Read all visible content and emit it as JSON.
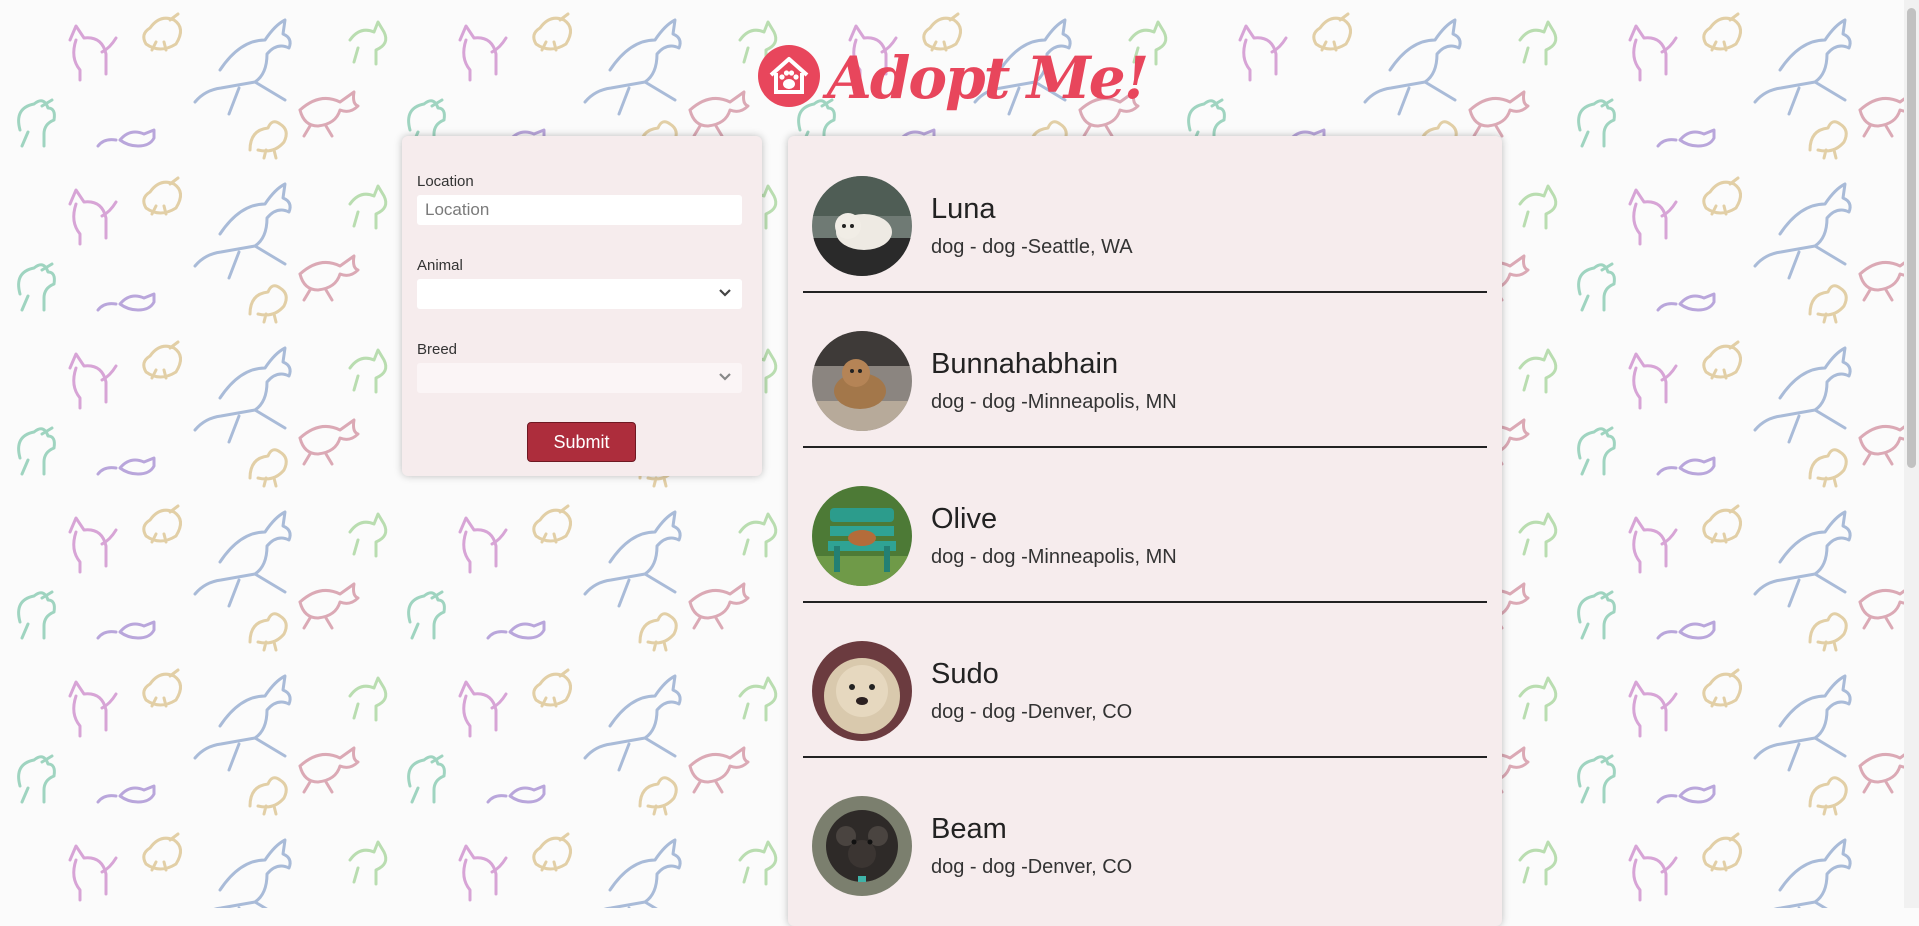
{
  "brand": {
    "title": "Adopt Me!",
    "logo_icon": "house-paw-icon",
    "color": "#e8465c"
  },
  "search": {
    "location": {
      "label": "Location",
      "placeholder": "Location",
      "value": ""
    },
    "animal": {
      "label": "Animal",
      "value": ""
    },
    "breed": {
      "label": "Breed",
      "value": ""
    },
    "submit_label": "Submit",
    "submit_color": "#ad2d3c"
  },
  "results": [
    {
      "name": "Luna",
      "info": "dog - dog -Seattle, WA"
    },
    {
      "name": "Bunnahabhain",
      "info": "dog - dog -Minneapolis, MN"
    },
    {
      "name": "Olive",
      "info": "dog - dog -Minneapolis, MN"
    },
    {
      "name": "Sudo",
      "info": "dog - dog -Denver, CO"
    },
    {
      "name": "Beam",
      "info": "dog - dog -Denver, CO"
    }
  ]
}
